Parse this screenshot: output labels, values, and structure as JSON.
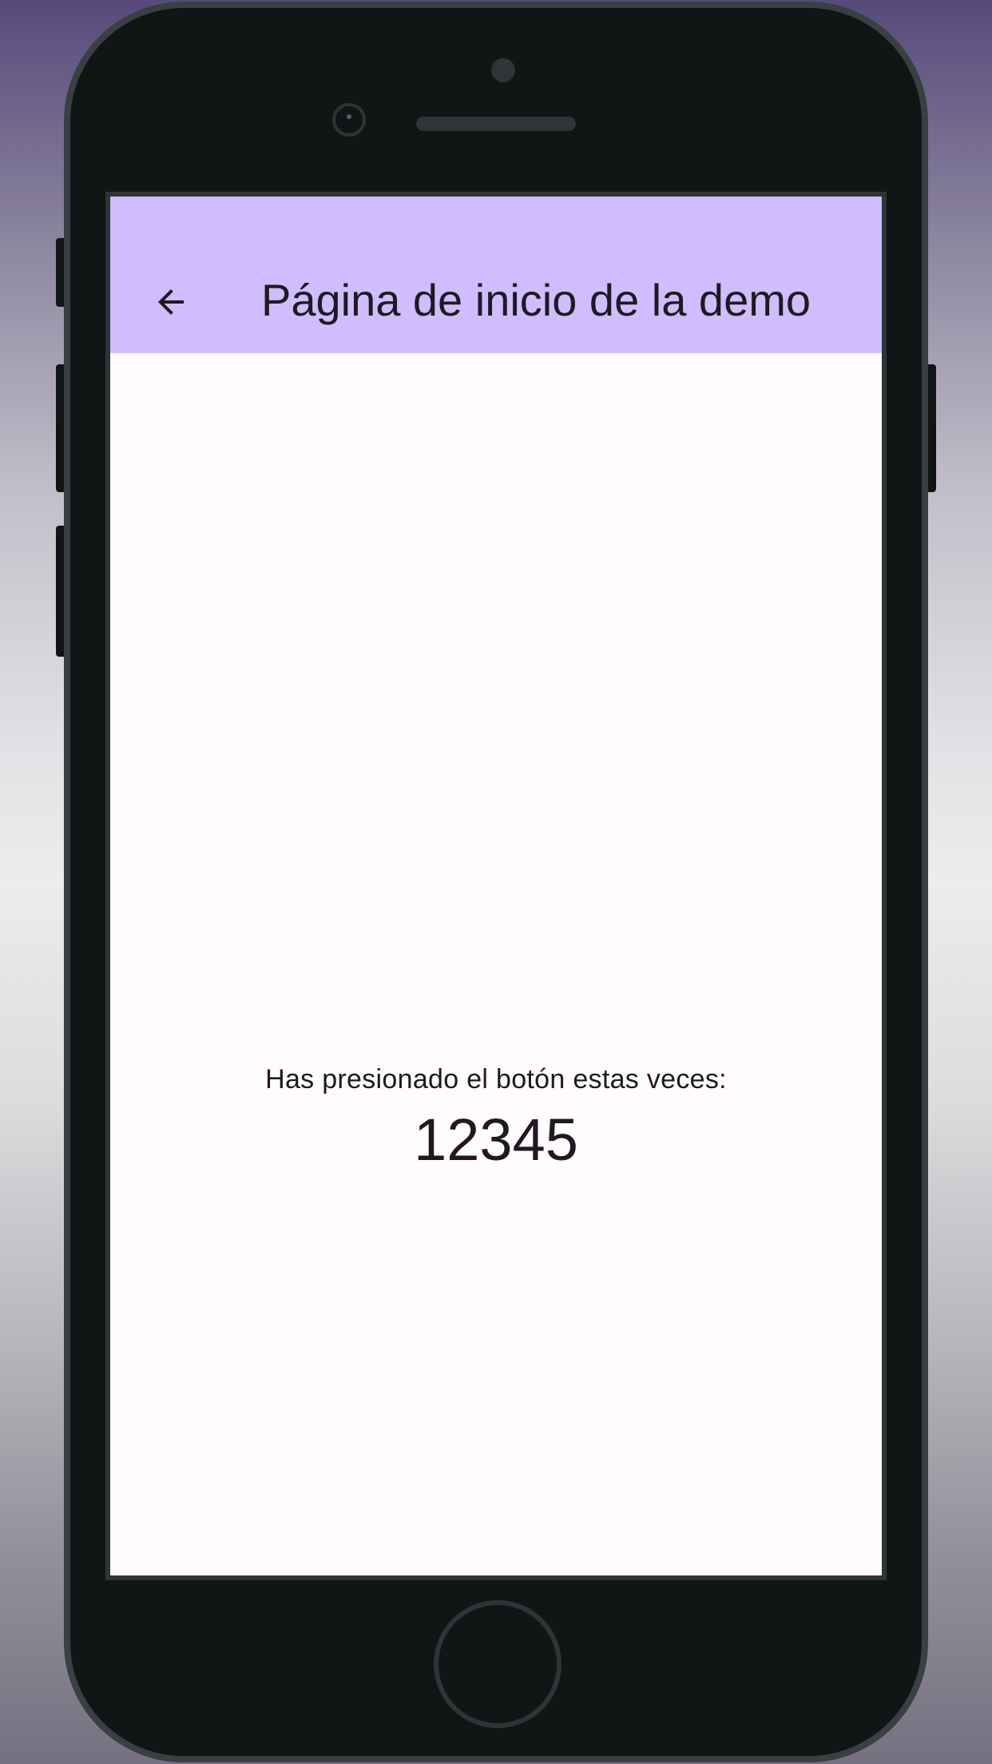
{
  "app_bar": {
    "title": "Página de inicio de la demo",
    "back_icon": "arrow-back-icon",
    "background_color": "#d0bcff"
  },
  "content": {
    "counter_label": "Has presionado el botón estas veces:",
    "counter_value": "12345"
  },
  "fab": {
    "icon": "plus-icon",
    "background_color": "#eaddff",
    "icon_color": "#21005d"
  },
  "device": {
    "frame_color": "#121516"
  }
}
